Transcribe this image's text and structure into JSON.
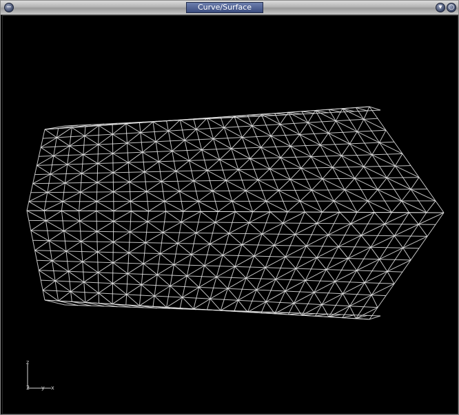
{
  "window": {
    "title": "Curve/Surface"
  },
  "titlebar_buttons": {
    "close_icon": "circle-minus-icon",
    "shade_icon": "chevron-down-icon",
    "maximize_icon": "circle-restore-icon"
  },
  "viewport": {
    "background": "#000000",
    "wire_color": "#e6e6e6",
    "grid": {
      "long_divisions": 24,
      "cross_divisions": 9
    }
  },
  "axis_triad": {
    "z": "z",
    "y": "y",
    "x": "x",
    "origin": "2"
  }
}
